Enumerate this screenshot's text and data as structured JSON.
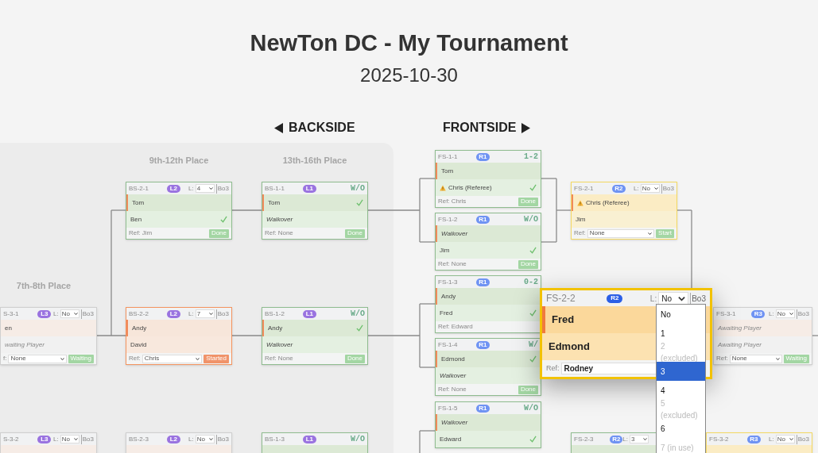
{
  "title": "NewTon DC - My Tournament",
  "date": "2025-10-30",
  "sides": [
    {
      "label": "BACKSIDE",
      "kind": "backside"
    },
    {
      "label": "FRONTSIDE",
      "kind": "frontside"
    }
  ],
  "round_titles": [
    "9th-12th Place",
    "13th-16th Place",
    "7th-8th Place"
  ],
  "matches": [
    {
      "id": "BS-2-1",
      "badge": {
        "label": "L2",
        "color": "#9a73e0"
      },
      "kind": "done",
      "lane_label": "L:",
      "lane": "4",
      "best_of": "Bo3",
      "players": [
        {
          "name": "Tom",
          "kind": "player",
          "marked": true,
          "winner": false,
          "warning": false
        },
        {
          "name": "Ben",
          "kind": "player",
          "marked": false,
          "winner": true,
          "warning": false
        }
      ],
      "ref_label": "Ref:",
      "referee": "Jim",
      "referee_editable": false,
      "action": "Done"
    },
    {
      "id": "BS-1-1",
      "badge": {
        "label": "L1",
        "color": "#9a73e0"
      },
      "kind": "done",
      "score": "W/O",
      "players": [
        {
          "name": "Tom",
          "kind": "player",
          "marked": true,
          "winner": true,
          "warning": false
        },
        {
          "name": "Walkover",
          "kind": "walkover",
          "marked": false,
          "winner": false,
          "warning": false
        }
      ],
      "ref_label": "Ref:",
      "referee": "None",
      "referee_editable": false,
      "action": "Done"
    },
    {
      "id": "FS-1-1",
      "badge": {
        "label": "R1",
        "color": "#6f93f3"
      },
      "kind": "done",
      "score": "1-2",
      "players": [
        {
          "name": "Tom",
          "kind": "player",
          "marked": true,
          "winner": false,
          "warning": false
        },
        {
          "name": "Chris (Referee)",
          "kind": "player",
          "marked": false,
          "winner": true,
          "warning": true
        }
      ],
      "ref_label": "Ref:",
      "referee": "Chris",
      "referee_editable": false,
      "action": "Done"
    },
    {
      "id": "FS-2-1",
      "badge": {
        "label": "R2",
        "color": "#6f93f3"
      },
      "kind": "ready",
      "lane_label": "L:",
      "lane": "No",
      "best_of": "Bo3",
      "players": [
        {
          "name": "Chris (Referee)",
          "kind": "player",
          "marked": true,
          "winner": false,
          "warning": true
        },
        {
          "name": "Jim",
          "kind": "player",
          "marked": false,
          "winner": false,
          "warning": false
        }
      ],
      "ref_label": "Ref:",
      "referee": "None",
      "referee_editable": true,
      "action": "Start"
    },
    {
      "id": "FS-1-2",
      "badge": {
        "label": "R1",
        "color": "#6f93f3"
      },
      "kind": "done",
      "score": "W/O",
      "players": [
        {
          "name": "Walkover",
          "kind": "walkover",
          "marked": true,
          "winner": false,
          "warning": false
        },
        {
          "name": "Jim",
          "kind": "player",
          "marked": false,
          "winner": true,
          "warning": false
        }
      ],
      "ref_label": "Ref:",
      "referee": "None",
      "referee_editable": false,
      "action": "Done"
    },
    {
      "id": "S-3-1",
      "badge": {
        "label": "L3",
        "color": "#9a73e0"
      },
      "kind": "waiting",
      "lane_label": "L:",
      "lane": "No",
      "best_of": "Bo3",
      "players": [
        {
          "name": "en",
          "kind": "player",
          "marked": false,
          "winner": false,
          "warning": false
        },
        {
          "name": "waiting Player",
          "kind": "awaiting",
          "marked": false,
          "winner": false,
          "warning": false
        }
      ],
      "ref_label": "f:",
      "referee": "None",
      "referee_editable": true,
      "action": "Waiting"
    },
    {
      "id": "BS-2-2",
      "badge": {
        "label": "L2",
        "color": "#9a73e0"
      },
      "kind": "started",
      "lane_label": "L:",
      "lane": "7",
      "best_of": "Bo3",
      "players": [
        {
          "name": "Andy",
          "kind": "player",
          "marked": true,
          "winner": false,
          "warning": false
        },
        {
          "name": "David",
          "kind": "player",
          "marked": false,
          "winner": false,
          "warning": false
        }
      ],
      "ref_label": "Ref:",
      "referee": "Chris",
      "referee_editable": true,
      "action": "Started"
    },
    {
      "id": "BS-1-2",
      "badge": {
        "label": "L1",
        "color": "#9a73e0"
      },
      "kind": "done",
      "score": "W/O",
      "players": [
        {
          "name": "Andy",
          "kind": "player",
          "marked": true,
          "winner": true,
          "warning": false
        },
        {
          "name": "Walkover",
          "kind": "walkover",
          "marked": false,
          "winner": false,
          "warning": false
        }
      ],
      "ref_label": "Ref:",
      "referee": "None",
      "referee_editable": false,
      "action": "Done"
    },
    {
      "id": "FS-1-3",
      "badge": {
        "label": "R1",
        "color": "#6f93f3"
      },
      "kind": "done",
      "score": "0-2",
      "players": [
        {
          "name": "Andy",
          "kind": "player",
          "marked": true,
          "winner": false,
          "warning": false
        },
        {
          "name": "Fred",
          "kind": "player",
          "marked": false,
          "winner": true,
          "warning": false
        }
      ],
      "ref_label": "Ref:",
      "referee": "Edward",
      "referee_editable": false
    },
    {
      "id": "FS-1-4",
      "badge": {
        "label": "R1",
        "color": "#6f93f3"
      },
      "kind": "done",
      "score": "W/",
      "players": [
        {
          "name": "Edmond",
          "kind": "player",
          "marked": true,
          "winner": true,
          "warning": false
        },
        {
          "name": "Walkover",
          "kind": "walkover",
          "marked": false,
          "winner": false,
          "warning": false
        }
      ],
      "ref_label": "Ref:",
      "referee": "None",
      "referee_editable": false,
      "action": "Done"
    },
    {
      "id": "FS-1-5",
      "badge": {
        "label": "R1",
        "color": "#6f93f3"
      },
      "kind": "done",
      "score": "W/O",
      "players": [
        {
          "name": "Walkover",
          "kind": "walkover",
          "marked": true,
          "winner": false,
          "warning": false
        },
        {
          "name": "Edward",
          "kind": "player",
          "marked": false,
          "winner": true,
          "warning": false
        }
      ]
    },
    {
      "id": "FS-3-1",
      "badge": {
        "label": "R3",
        "color": "#6f93f3"
      },
      "kind": "waiting",
      "lane_label": "L:",
      "lane": "No",
      "best_of": "Bo3",
      "players": [
        {
          "name": "Awaiting Player",
          "kind": "awaiting",
          "marked": false,
          "winner": false,
          "warning": false
        },
        {
          "name": "Awaiting Player",
          "kind": "awaiting",
          "marked": false,
          "winner": false,
          "warning": false
        }
      ],
      "ref_label": "Ref:",
      "referee": "None",
      "referee_editable": true,
      "action": "Waiting"
    },
    {
      "id": "S-3-2",
      "badge": {
        "label": "L3",
        "color": "#9a73e0"
      },
      "kind": "waiting",
      "lane_label": "L:",
      "lane": "No",
      "best_of": "Bo3"
    },
    {
      "id": "BS-2-3",
      "badge": {
        "label": "L2",
        "color": "#9a73e0"
      },
      "kind": "waiting",
      "lane_label": "L:",
      "lane": "No",
      "best_of": "Bo3"
    },
    {
      "id": "BS-1-3",
      "badge": {
        "label": "L1",
        "color": "#9a73e0"
      },
      "kind": "done",
      "score": "W/O"
    },
    {
      "id": "FS-2-3",
      "badge": {
        "label": "R2",
        "color": "#6f93f3"
      },
      "kind": "done",
      "lane_label": "L:",
      "lane": "3"
    },
    {
      "id": "FS-3-2",
      "badge": {
        "label": "R3",
        "color": "#6f93f3"
      },
      "kind": "ready",
      "lane_label": "L:",
      "lane": "No",
      "best_of": "Bo3"
    },
    {
      "id": "FS-2-2",
      "badge": {
        "label": "R2",
        "color": "#2b5fe6"
      },
      "kind": "active",
      "lane_label": "L:",
      "lane": "No",
      "best_of": "Bo3",
      "players": [
        {
          "name": "Fred",
          "kind": "player",
          "marked": true,
          "warning": false
        },
        {
          "name": "Edmond",
          "kind": "player",
          "marked": false,
          "warning": false
        }
      ],
      "ref_label": "Ref:",
      "referee": "Rodney",
      "referee_editable": true,
      "lane_menu": [
        {
          "label": "No",
          "disabled": false,
          "selected": false
        },
        {
          "label": "1",
          "disabled": false,
          "selected": false
        },
        {
          "label": "2 (excluded)",
          "disabled": true,
          "selected": false
        },
        {
          "label": "3",
          "disabled": false,
          "selected": true
        },
        {
          "label": "4",
          "disabled": false,
          "selected": false
        },
        {
          "label": "5 (excluded)",
          "disabled": true,
          "selected": false
        },
        {
          "label": "6",
          "disabled": false,
          "selected": false
        },
        {
          "label": "7 (in use)",
          "disabled": true,
          "selected": false
        }
      ]
    }
  ]
}
